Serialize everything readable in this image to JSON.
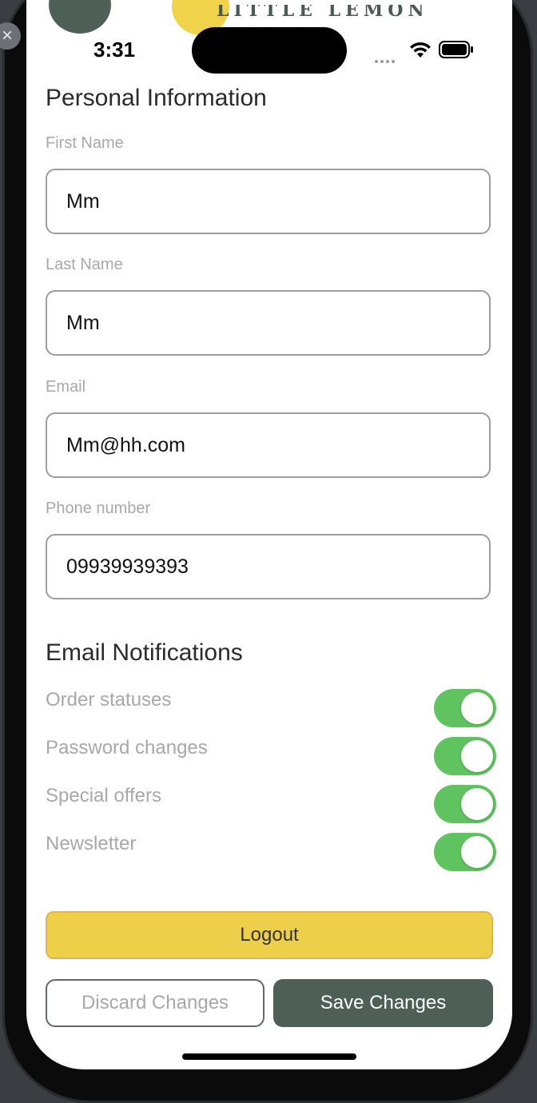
{
  "status_bar": {
    "time": "3:31"
  },
  "header": {
    "logo_text": "LITTLE LEMON"
  },
  "personal_info": {
    "title": "Personal Information",
    "fields": [
      {
        "label": "First Name",
        "value": "Mm"
      },
      {
        "label": "Last Name",
        "value": "Mm"
      },
      {
        "label": "Email",
        "value": "Mm@hh.com"
      },
      {
        "label": "Phone number",
        "value": "09939939393"
      }
    ]
  },
  "notifications": {
    "title": "Email Notifications",
    "items": [
      {
        "label": "Order statuses",
        "on": true
      },
      {
        "label": "Password changes",
        "on": true
      },
      {
        "label": "Special offers",
        "on": true
      },
      {
        "label": "Newsletter",
        "on": true
      }
    ]
  },
  "actions": {
    "logout_label": "Logout",
    "discard_label": "Discard Changes",
    "save_label": "Save Changes"
  },
  "colors": {
    "toggle_on": "#5fc35f",
    "primary": "#4e5f57",
    "accent": "#eecf49"
  },
  "icons": [
    "close-icon",
    "wifi-icon",
    "battery-icon",
    "signal-icon"
  ]
}
